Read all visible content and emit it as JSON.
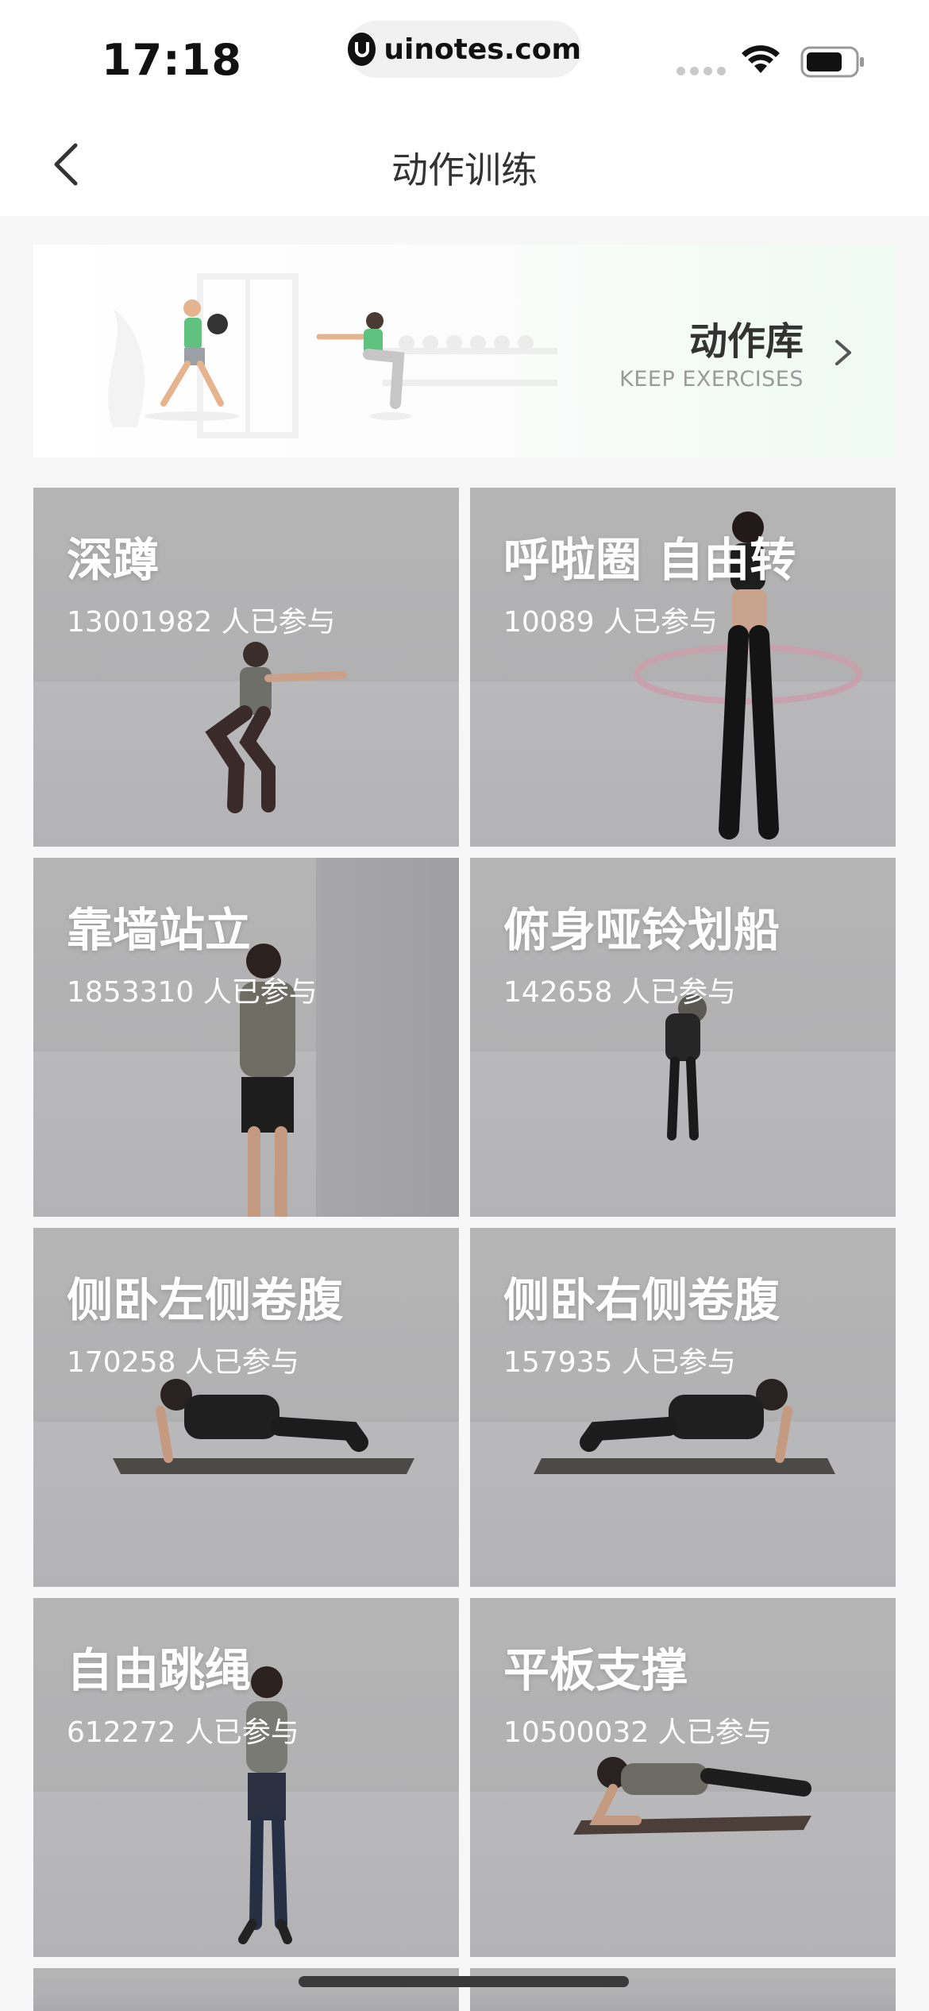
{
  "status_bar": {
    "time": "17:18",
    "url": "uinotes.com"
  },
  "nav": {
    "title": "动作训练"
  },
  "banner": {
    "title": "动作库",
    "subtitle": "KEEP EXERCISES"
  },
  "exercises": [
    {
      "title": "深蹲",
      "count": "13001982 人已参与"
    },
    {
      "title": "呼啦圈 自由转",
      "count": "10089 人已参与"
    },
    {
      "title": "靠墙站立",
      "count": "1853310 人已参与"
    },
    {
      "title": "俯身哑铃划船",
      "count": "142658 人已参与"
    },
    {
      "title": "侧卧左侧卷腹",
      "count": "170258 人已参与"
    },
    {
      "title": "侧卧右侧卷腹",
      "count": "157935 人已参与"
    },
    {
      "title": "自由跳绳",
      "count": "612272 人已参与"
    },
    {
      "title": "平板支撑",
      "count": "10500032 人已参与"
    }
  ],
  "colors": {
    "accent_green": "#5fc27e",
    "card_gray": "#b2b2b4"
  }
}
